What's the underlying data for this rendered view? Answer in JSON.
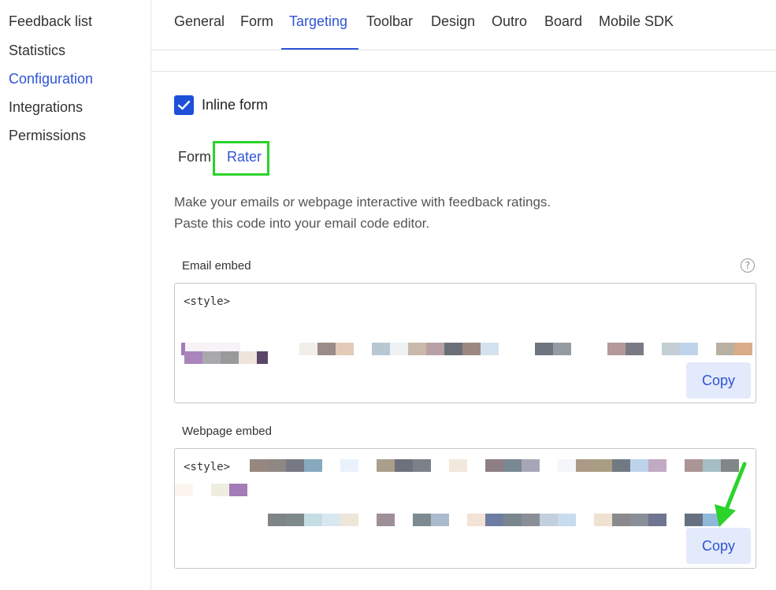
{
  "sidebar": {
    "items": [
      {
        "label": "Feedback list",
        "active": false
      },
      {
        "label": "Statistics",
        "active": false
      },
      {
        "label": "Configuration",
        "active": true
      },
      {
        "label": "Integrations",
        "active": false
      },
      {
        "label": "Permissions",
        "active": false
      }
    ]
  },
  "tabs": [
    "General",
    "Form",
    "Targeting",
    "Toolbar",
    "Design",
    "Outro",
    "Board",
    "Mobile SDK"
  ],
  "active_tab": "Targeting",
  "inline_form": {
    "label": "Inline form",
    "checked": true
  },
  "subtabs": {
    "form": "Form",
    "rater": "Rater",
    "active": "Rater"
  },
  "description": {
    "line1": "Make your emails or webpage interactive with feedback ratings.",
    "line2": "Paste this code into your email code editor."
  },
  "email_embed": {
    "label": "Email embed",
    "code": "<style>",
    "copy_label": "Copy"
  },
  "webpage_embed": {
    "label": "Webpage embed",
    "code": "<style>",
    "copy_label": "Copy"
  },
  "help_icon": "?",
  "colors": {
    "accent": "#2f54d6",
    "highlight": "#2bd32b",
    "checkbox": "#1e4fd8"
  }
}
